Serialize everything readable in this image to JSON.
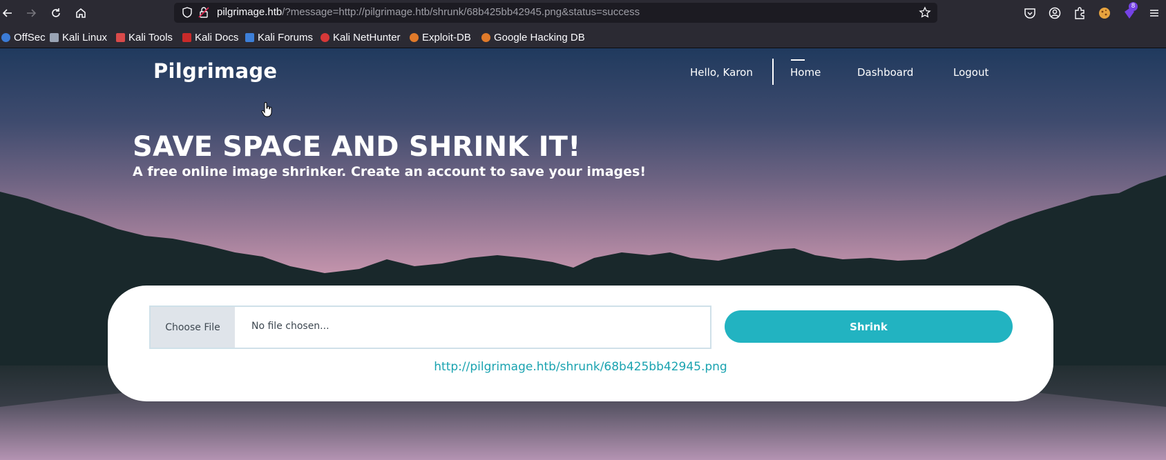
{
  "browser": {
    "url_host": "pilgrimage.htb",
    "url_rest": "/?message=http://pilgrimage.htb/shrunk/68b425bb42945.png&status=success",
    "extensions_badge": "8",
    "bookmarks": [
      {
        "label": "OffSec",
        "color": "#3b7bd6"
      },
      {
        "label": "Kali Linux",
        "color": "#9aa4b5"
      },
      {
        "label": "Kali Tools",
        "color": "#d94a4a"
      },
      {
        "label": "Kali Docs",
        "color": "#c92a2a"
      },
      {
        "label": "Kali Forums",
        "color": "#3d7fd8"
      },
      {
        "label": "Kali NetHunter",
        "color": "#d63838"
      },
      {
        "label": "Exploit-DB",
        "color": "#e07a2a"
      },
      {
        "label": "Google Hacking DB",
        "color": "#e07a2a"
      }
    ]
  },
  "site": {
    "brand": "Pilgrimage",
    "nav": {
      "greeting": "Hello, Karon",
      "home": "Home",
      "dashboard": "Dashboard",
      "logout": "Logout"
    },
    "hero": {
      "title": "SAVE SPACE AND SHRINK IT!",
      "subtitle": "A free online image shrinker. Create an account to save your images!"
    },
    "upload": {
      "choose_label": "Choose File",
      "file_status": "No file chosen...",
      "submit_label": "Shrink",
      "result_link": "http://pilgrimage.htb/shrunk/68b425bb42945.png"
    }
  },
  "colors": {
    "accent": "#22b3c1",
    "link": "#1aa3b0",
    "chrome_bg": "#2b2a33",
    "urlbar_bg": "#1c1b22"
  }
}
